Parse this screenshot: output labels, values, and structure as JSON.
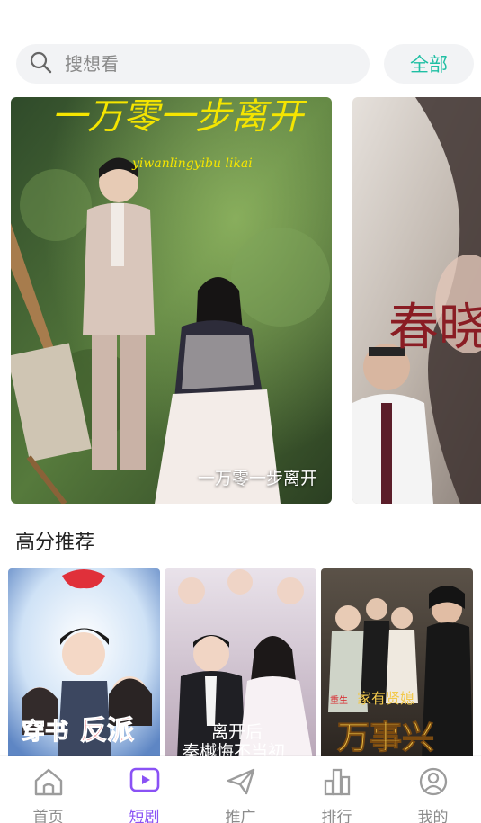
{
  "search": {
    "placeholder": "搜想看",
    "all_label": "全部"
  },
  "banners": [
    {
      "caption": "一万零一步离开",
      "art_title": "一万零一步离开",
      "art_pinyin": "yiwanlingyibu likai"
    },
    {
      "art_title": "春晓"
    }
  ],
  "section": {
    "title": "高分推荐"
  },
  "posters": [
    {
      "art_text_1": "穿书",
      "art_text_2": "反派"
    },
    {
      "art_text_1": "离开后",
      "art_text_2": "秦樾悔不当初"
    },
    {
      "art_text_1": "家有贤媳",
      "art_text_2": "万事兴",
      "art_badge": "重生"
    }
  ],
  "tabbar": {
    "items": [
      {
        "label": "首页",
        "icon": "home-icon"
      },
      {
        "label": "短剧",
        "icon": "play-icon",
        "active": true
      },
      {
        "label": "推广",
        "icon": "paper-plane-icon"
      },
      {
        "label": "排行",
        "icon": "bar-chart-icon"
      },
      {
        "label": "我的",
        "icon": "profile-icon"
      }
    ]
  },
  "colors": {
    "accent": "#8a52f5",
    "all_button": "#1fbfa3",
    "search_bg": "#f2f3f5"
  }
}
